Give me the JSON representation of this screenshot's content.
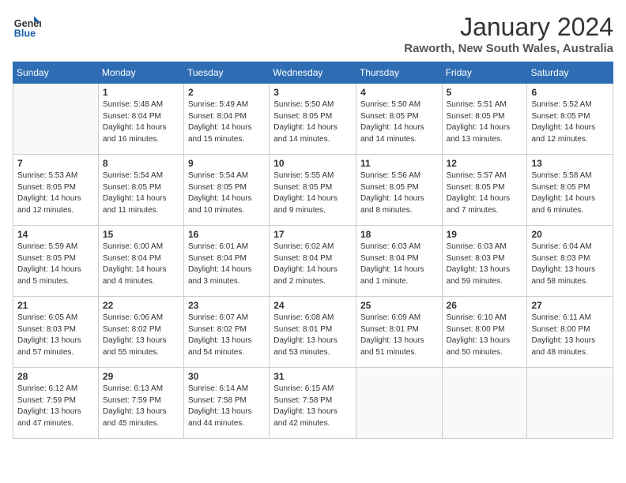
{
  "logo": {
    "line1": "General",
    "line2": "Blue"
  },
  "title": "January 2024",
  "subtitle": "Raworth, New South Wales, Australia",
  "days_of_week": [
    "Sunday",
    "Monday",
    "Tuesday",
    "Wednesday",
    "Thursday",
    "Friday",
    "Saturday"
  ],
  "weeks": [
    [
      {
        "day": "",
        "sunrise": "",
        "sunset": "",
        "daylight": ""
      },
      {
        "day": "1",
        "sunrise": "Sunrise: 5:48 AM",
        "sunset": "Sunset: 8:04 PM",
        "daylight": "Daylight: 14 hours and 16 minutes."
      },
      {
        "day": "2",
        "sunrise": "Sunrise: 5:49 AM",
        "sunset": "Sunset: 8:04 PM",
        "daylight": "Daylight: 14 hours and 15 minutes."
      },
      {
        "day": "3",
        "sunrise": "Sunrise: 5:50 AM",
        "sunset": "Sunset: 8:05 PM",
        "daylight": "Daylight: 14 hours and 14 minutes."
      },
      {
        "day": "4",
        "sunrise": "Sunrise: 5:50 AM",
        "sunset": "Sunset: 8:05 PM",
        "daylight": "Daylight: 14 hours and 14 minutes."
      },
      {
        "day": "5",
        "sunrise": "Sunrise: 5:51 AM",
        "sunset": "Sunset: 8:05 PM",
        "daylight": "Daylight: 14 hours and 13 minutes."
      },
      {
        "day": "6",
        "sunrise": "Sunrise: 5:52 AM",
        "sunset": "Sunset: 8:05 PM",
        "daylight": "Daylight: 14 hours and 12 minutes."
      }
    ],
    [
      {
        "day": "7",
        "sunrise": "Sunrise: 5:53 AM",
        "sunset": "Sunset: 8:05 PM",
        "daylight": "Daylight: 14 hours and 12 minutes."
      },
      {
        "day": "8",
        "sunrise": "Sunrise: 5:54 AM",
        "sunset": "Sunset: 8:05 PM",
        "daylight": "Daylight: 14 hours and 11 minutes."
      },
      {
        "day": "9",
        "sunrise": "Sunrise: 5:54 AM",
        "sunset": "Sunset: 8:05 PM",
        "daylight": "Daylight: 14 hours and 10 minutes."
      },
      {
        "day": "10",
        "sunrise": "Sunrise: 5:55 AM",
        "sunset": "Sunset: 8:05 PM",
        "daylight": "Daylight: 14 hours and 9 minutes."
      },
      {
        "day": "11",
        "sunrise": "Sunrise: 5:56 AM",
        "sunset": "Sunset: 8:05 PM",
        "daylight": "Daylight: 14 hours and 8 minutes."
      },
      {
        "day": "12",
        "sunrise": "Sunrise: 5:57 AM",
        "sunset": "Sunset: 8:05 PM",
        "daylight": "Daylight: 14 hours and 7 minutes."
      },
      {
        "day": "13",
        "sunrise": "Sunrise: 5:58 AM",
        "sunset": "Sunset: 8:05 PM",
        "daylight": "Daylight: 14 hours and 6 minutes."
      }
    ],
    [
      {
        "day": "14",
        "sunrise": "Sunrise: 5:59 AM",
        "sunset": "Sunset: 8:05 PM",
        "daylight": "Daylight: 14 hours and 5 minutes."
      },
      {
        "day": "15",
        "sunrise": "Sunrise: 6:00 AM",
        "sunset": "Sunset: 8:04 PM",
        "daylight": "Daylight: 14 hours and 4 minutes."
      },
      {
        "day": "16",
        "sunrise": "Sunrise: 6:01 AM",
        "sunset": "Sunset: 8:04 PM",
        "daylight": "Daylight: 14 hours and 3 minutes."
      },
      {
        "day": "17",
        "sunrise": "Sunrise: 6:02 AM",
        "sunset": "Sunset: 8:04 PM",
        "daylight": "Daylight: 14 hours and 2 minutes."
      },
      {
        "day": "18",
        "sunrise": "Sunrise: 6:03 AM",
        "sunset": "Sunset: 8:04 PM",
        "daylight": "Daylight: 14 hours and 1 minute."
      },
      {
        "day": "19",
        "sunrise": "Sunrise: 6:03 AM",
        "sunset": "Sunset: 8:03 PM",
        "daylight": "Daylight: 13 hours and 59 minutes."
      },
      {
        "day": "20",
        "sunrise": "Sunrise: 6:04 AM",
        "sunset": "Sunset: 8:03 PM",
        "daylight": "Daylight: 13 hours and 58 minutes."
      }
    ],
    [
      {
        "day": "21",
        "sunrise": "Sunrise: 6:05 AM",
        "sunset": "Sunset: 8:03 PM",
        "daylight": "Daylight: 13 hours and 57 minutes."
      },
      {
        "day": "22",
        "sunrise": "Sunrise: 6:06 AM",
        "sunset": "Sunset: 8:02 PM",
        "daylight": "Daylight: 13 hours and 55 minutes."
      },
      {
        "day": "23",
        "sunrise": "Sunrise: 6:07 AM",
        "sunset": "Sunset: 8:02 PM",
        "daylight": "Daylight: 13 hours and 54 minutes."
      },
      {
        "day": "24",
        "sunrise": "Sunrise: 6:08 AM",
        "sunset": "Sunset: 8:01 PM",
        "daylight": "Daylight: 13 hours and 53 minutes."
      },
      {
        "day": "25",
        "sunrise": "Sunrise: 6:09 AM",
        "sunset": "Sunset: 8:01 PM",
        "daylight": "Daylight: 13 hours and 51 minutes."
      },
      {
        "day": "26",
        "sunrise": "Sunrise: 6:10 AM",
        "sunset": "Sunset: 8:00 PM",
        "daylight": "Daylight: 13 hours and 50 minutes."
      },
      {
        "day": "27",
        "sunrise": "Sunrise: 6:11 AM",
        "sunset": "Sunset: 8:00 PM",
        "daylight": "Daylight: 13 hours and 48 minutes."
      }
    ],
    [
      {
        "day": "28",
        "sunrise": "Sunrise: 6:12 AM",
        "sunset": "Sunset: 7:59 PM",
        "daylight": "Daylight: 13 hours and 47 minutes."
      },
      {
        "day": "29",
        "sunrise": "Sunrise: 6:13 AM",
        "sunset": "Sunset: 7:59 PM",
        "daylight": "Daylight: 13 hours and 45 minutes."
      },
      {
        "day": "30",
        "sunrise": "Sunrise: 6:14 AM",
        "sunset": "Sunset: 7:58 PM",
        "daylight": "Daylight: 13 hours and 44 minutes."
      },
      {
        "day": "31",
        "sunrise": "Sunrise: 6:15 AM",
        "sunset": "Sunset: 7:58 PM",
        "daylight": "Daylight: 13 hours and 42 minutes."
      },
      {
        "day": "",
        "sunrise": "",
        "sunset": "",
        "daylight": ""
      },
      {
        "day": "",
        "sunrise": "",
        "sunset": "",
        "daylight": ""
      },
      {
        "day": "",
        "sunrise": "",
        "sunset": "",
        "daylight": ""
      }
    ]
  ]
}
